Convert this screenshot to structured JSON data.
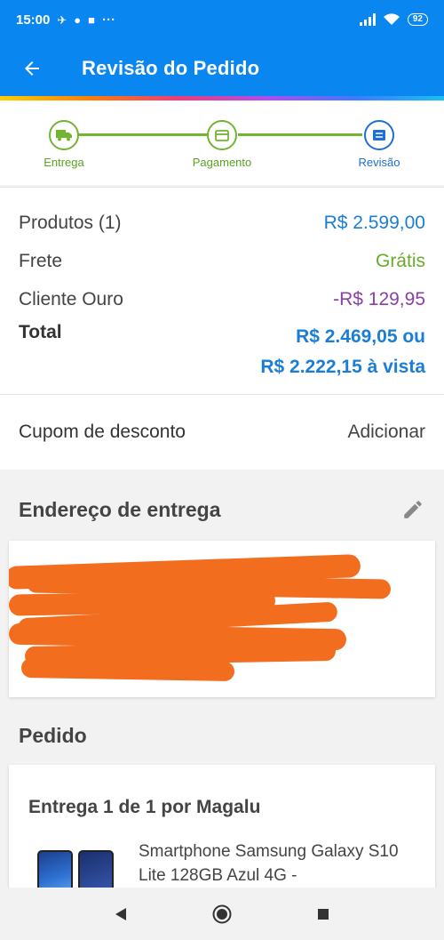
{
  "status_bar": {
    "time": "15:00",
    "more": "···",
    "battery": "92"
  },
  "header": {
    "title": "Revisão do Pedido"
  },
  "stepper": {
    "steps": [
      {
        "label": "Entrega"
      },
      {
        "label": "Pagamento"
      },
      {
        "label": "Revisão"
      }
    ]
  },
  "summary": {
    "products_label": "Produtos (1)",
    "products_value": "R$ 2.599,00",
    "shipping_label": "Frete",
    "shipping_value": "Grátis",
    "gold_label": "Cliente Ouro",
    "gold_value": "-R$ 129,95",
    "total_label": "Total",
    "total_value_line1": "R$ 2.469,05 ou",
    "total_value_line2": "R$ 2.222,15 à vista"
  },
  "coupon": {
    "label": "Cupom de desconto",
    "action": "Adicionar"
  },
  "address": {
    "title": "Endereço de entrega"
  },
  "order": {
    "title": "Pedido",
    "delivery_title": "Entrega 1 de 1 por Magalu",
    "product_name": "Smartphone Samsung Galaxy S10 Lite 128GB Azul 4G -"
  },
  "colors": {
    "brand_blue": "#0a86f0",
    "step_green": "#72b530",
    "price_blue": "#1b7ed6",
    "free_green": "#6aaa2c",
    "discount_purple": "#8a3fa7",
    "redaction_orange": "#f26d1e"
  },
  "icons": [
    "back-arrow-icon",
    "truck-icon",
    "card-icon",
    "review-icon",
    "edit-pencil-icon",
    "nav-back-icon",
    "nav-home-icon",
    "nav-recents-icon"
  ]
}
